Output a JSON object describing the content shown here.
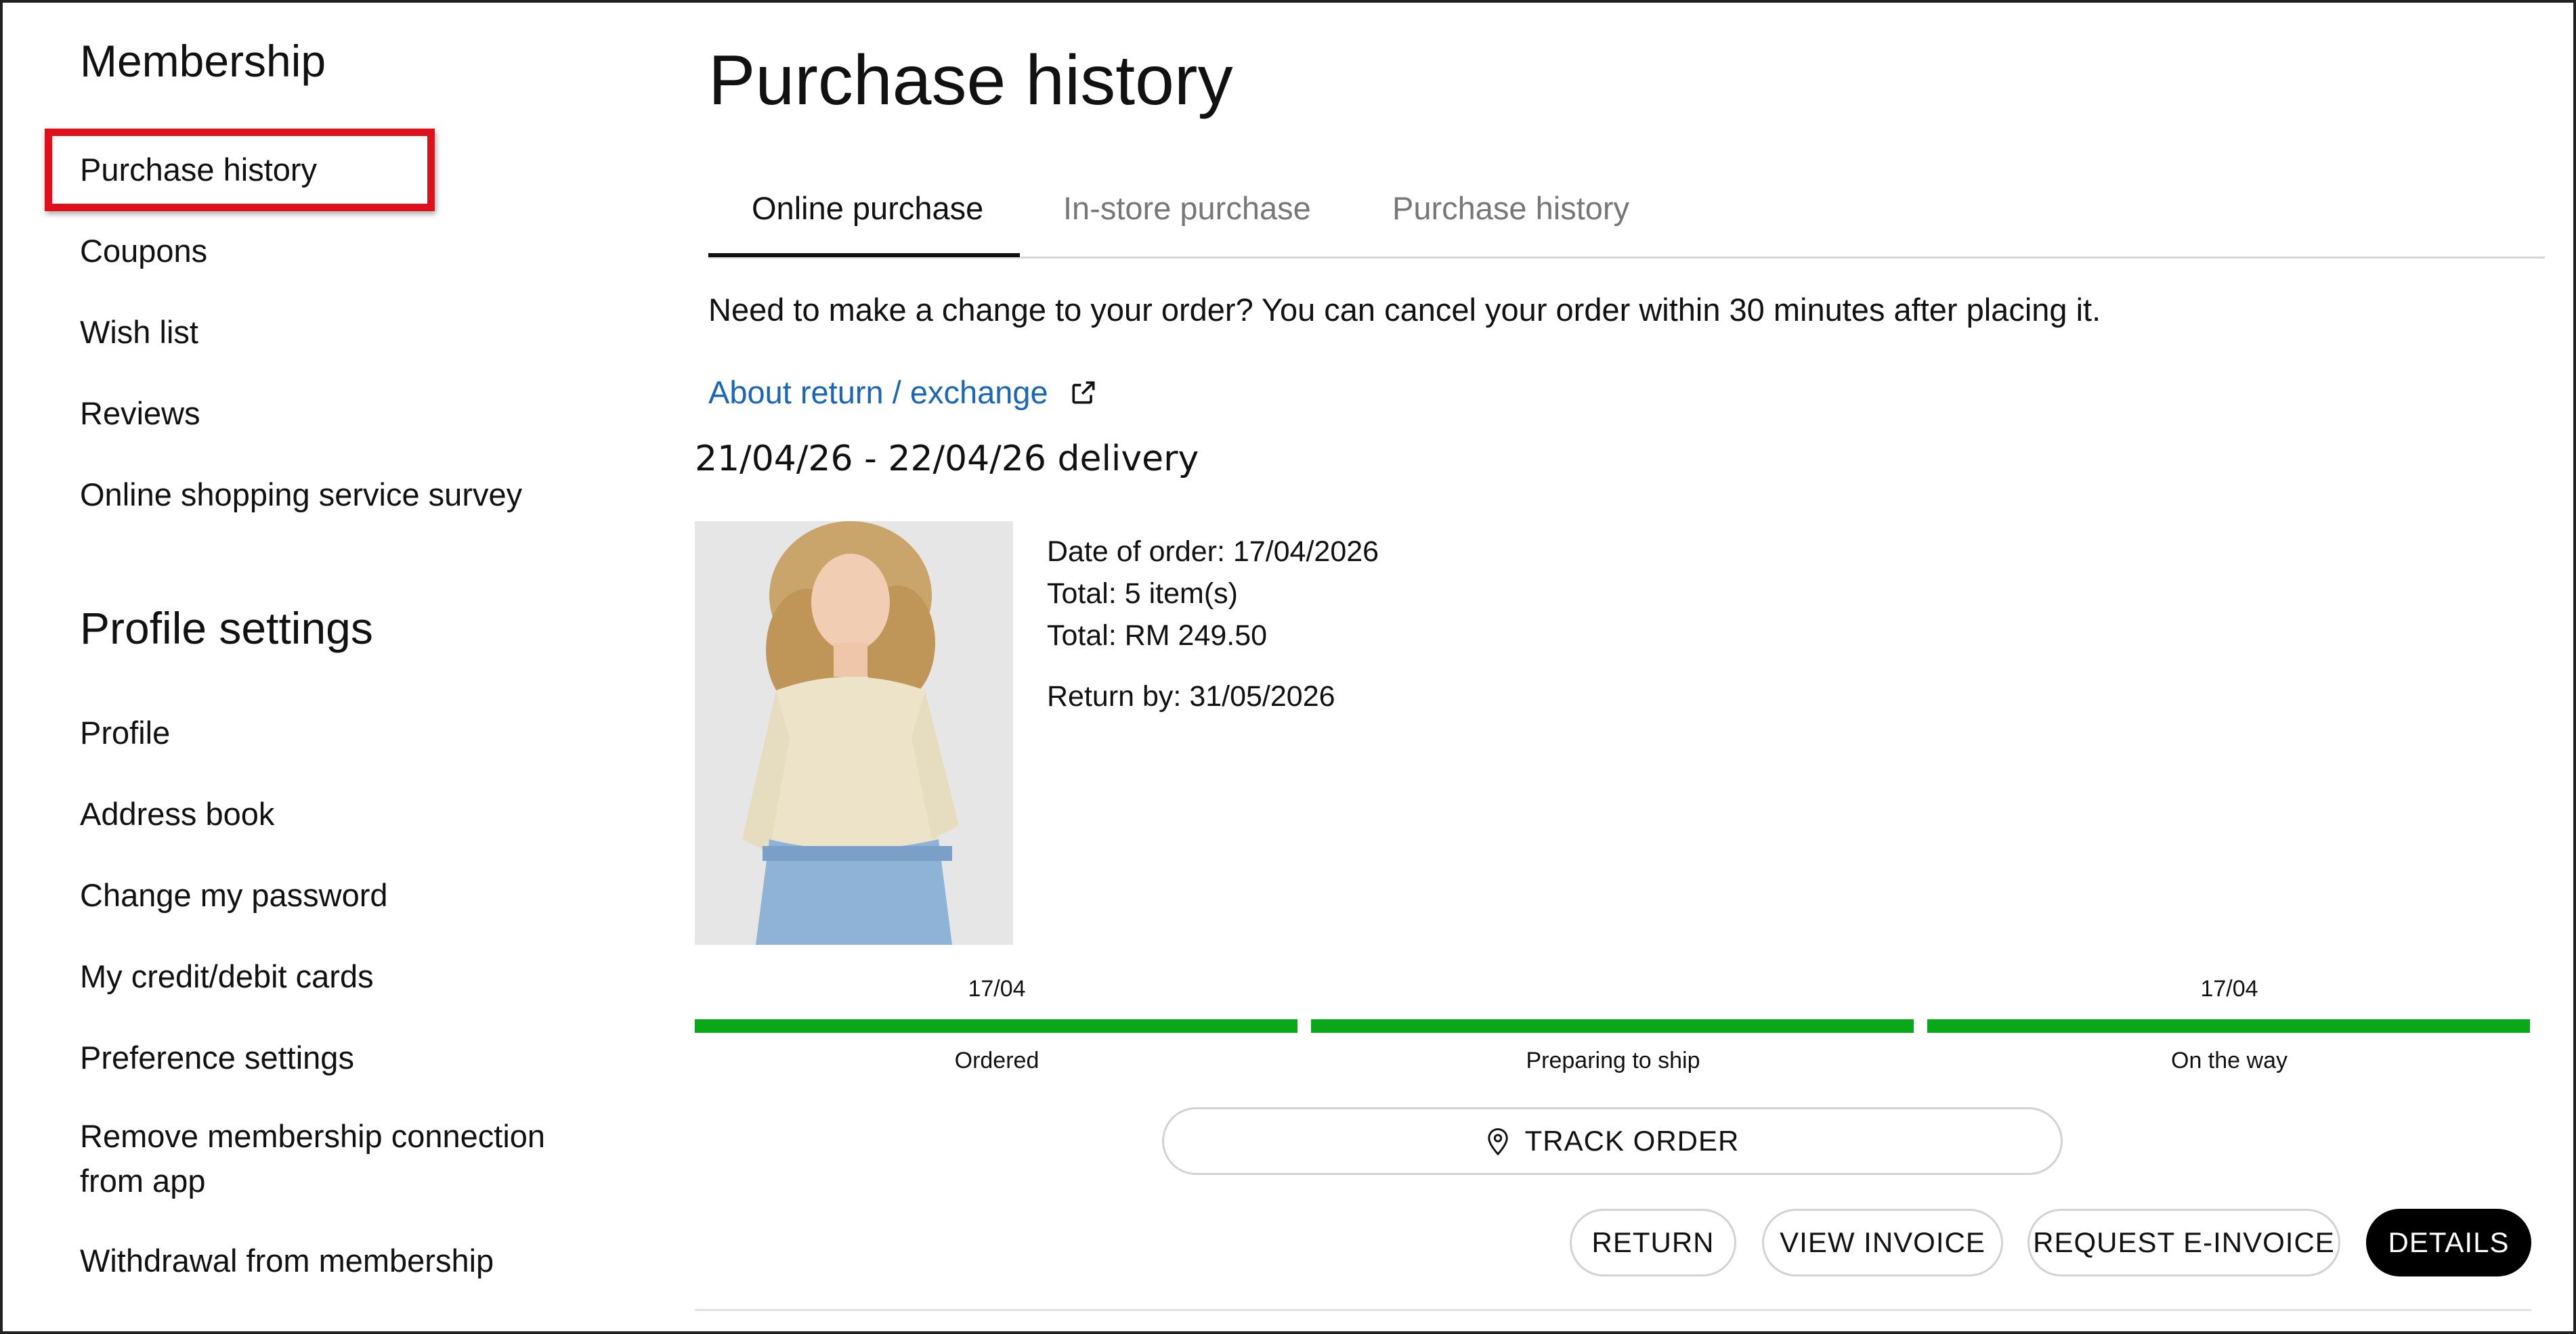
{
  "sidebar": {
    "membership_heading": "Membership",
    "membership_items": [
      {
        "label": "Purchase history"
      },
      {
        "label": "Coupons"
      },
      {
        "label": "Wish list"
      },
      {
        "label": "Reviews"
      },
      {
        "label": "Online shopping service survey"
      }
    ],
    "profile_heading": "Profile settings",
    "profile_items": [
      {
        "label": "Profile"
      },
      {
        "label": "Address book"
      },
      {
        "label": "Change my password"
      },
      {
        "label": "My credit/debit cards"
      },
      {
        "label": "Preference settings"
      },
      {
        "label": "Remove membership connection from app"
      },
      {
        "label": "Withdrawal from membership"
      }
    ]
  },
  "main": {
    "title": "Purchase history",
    "tabs": [
      {
        "label": "Online purchase",
        "active": true
      },
      {
        "label": "In-store purchase",
        "active": false
      },
      {
        "label": "Purchase history",
        "active": false
      }
    ],
    "notice": "Need to make a change to your order? You can cancel your order within 30 minutes after placing it.",
    "about_link": "About return / exchange",
    "delivery": "21/04/26 - 22/04/26 delivery",
    "order": {
      "date": "Date of order: 17/04/2026",
      "items": "Total: 5 item(s)",
      "total": "Total: RM 249.50",
      "return_by": "Return by: 31/05/2026"
    },
    "progress": [
      {
        "date": "17/04",
        "label": "Ordered"
      },
      {
        "date": "",
        "label": "Preparing to ship"
      },
      {
        "date": "17/04",
        "label": "On the way"
      }
    ],
    "buttons": {
      "track": "TRACK ORDER",
      "return": "RETURN",
      "view_invoice": "VIEW INVOICE",
      "request_einvoice": "REQUEST E-INVOICE",
      "details": "DETAILS"
    }
  },
  "colors": {
    "highlight": "#e0101a",
    "link": "#1a66b8",
    "progress": "#0aa818"
  },
  "icons": [
    "external-link-icon",
    "location-pin-icon"
  ]
}
